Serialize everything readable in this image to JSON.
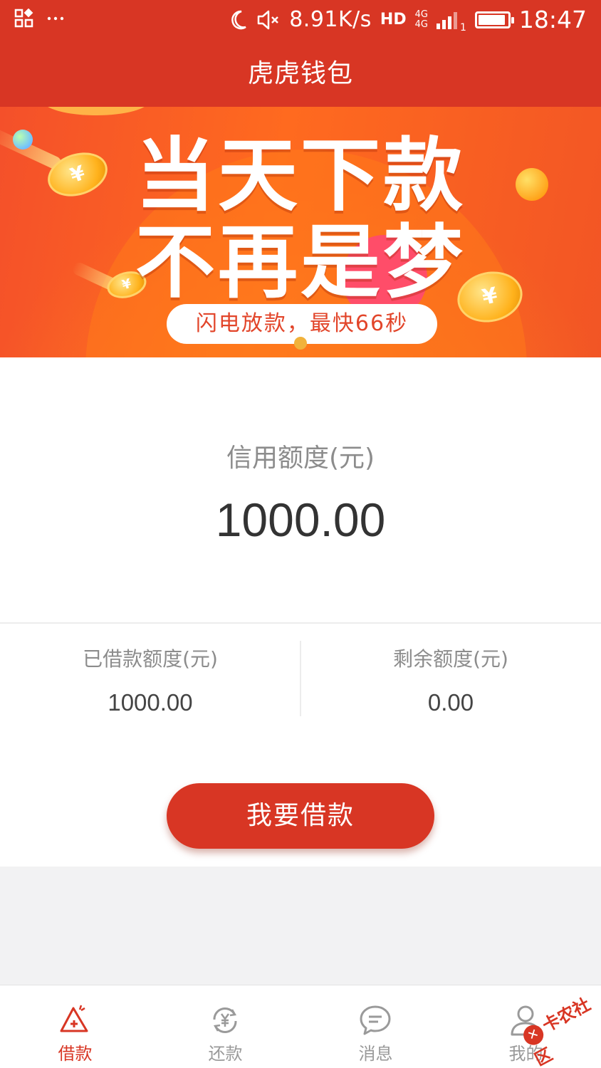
{
  "status_bar": {
    "network_speed": "8.91K/s",
    "hd_label": "HD",
    "network_type_1": "4G",
    "network_type_2": "4G",
    "sim_slot": "1",
    "time": "18:47",
    "battery_level": 0.92,
    "icons": [
      "grid-icon",
      "more-dots-icon",
      "moon-icon",
      "mute-icon",
      "signal-icon",
      "battery-icon"
    ]
  },
  "nav": {
    "title": "虎虎钱包"
  },
  "banner": {
    "headline_line1": "当天下款",
    "headline_line2": "不再是梦",
    "pill_text": "闪电放款，最快66秒",
    "coin_symbol": "¥",
    "page_count": 1,
    "active_page": 1
  },
  "credit": {
    "label": "信用额度(元)",
    "amount": "1000.00",
    "borrowed": {
      "label": "已借款额度(元)",
      "value": "1000.00"
    },
    "remaining": {
      "label": "剩余额度(元)",
      "value": "0.00"
    },
    "borrow_button": "我要借款"
  },
  "tab_bar": {
    "items": [
      {
        "label": "借款",
        "icon": "borrow-icon",
        "active": true
      },
      {
        "label": "还款",
        "icon": "repay-icon",
        "active": false
      },
      {
        "label": "消息",
        "icon": "message-icon",
        "active": false
      },
      {
        "label": "我的",
        "icon": "profile-icon",
        "active": false
      }
    ]
  },
  "watermark": {
    "text": "卡农社区"
  },
  "colors": {
    "brand_red": "#d83624",
    "text_gray": "#8c8c8c",
    "text_dark": "#333333",
    "background": "#f2f2f3"
  }
}
